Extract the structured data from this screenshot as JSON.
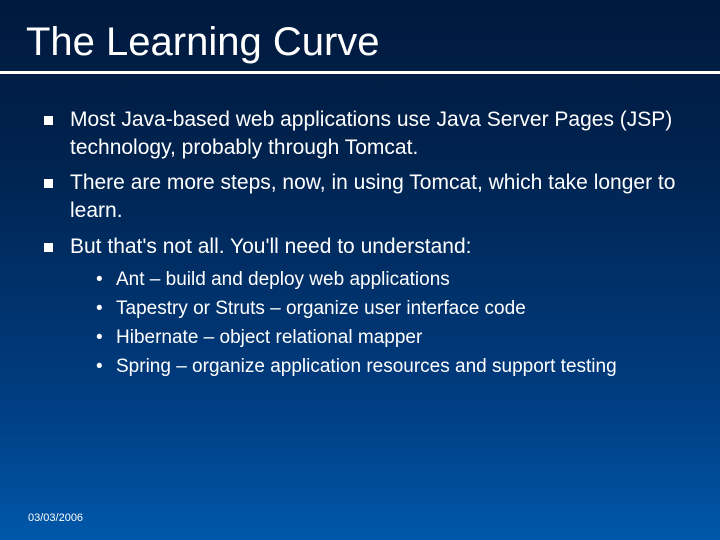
{
  "title": "The Learning Curve",
  "bullets": [
    {
      "text": "Most Java-based web  applications use Java Server Pages (JSP) technology, probably through Tomcat."
    },
    {
      "text": "There are more steps, now, in using Tomcat, which take longer to learn."
    },
    {
      "text": "But that's not all.  You'll need to understand:"
    }
  ],
  "sub_bullets": [
    {
      "text": "Ant – build and deploy web applications"
    },
    {
      "text": "Tapestry or Struts – organize user interface code"
    },
    {
      "text": "Hibernate – object relational mapper"
    },
    {
      "text": "Spring – organize application resources and support testing"
    }
  ],
  "date": "03/03/2006"
}
